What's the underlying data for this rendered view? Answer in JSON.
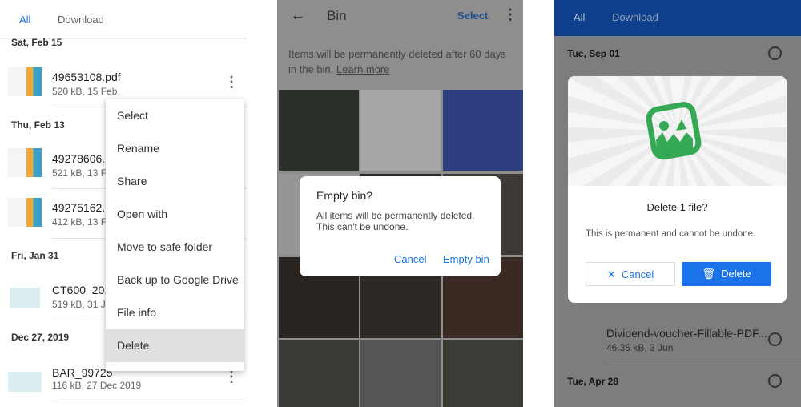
{
  "panel1": {
    "tabs": [
      "All",
      "Download"
    ],
    "groups": [
      {
        "date": "Sat, Feb 15"
      },
      {
        "date": "Thu, Feb 13"
      },
      {
        "date": "Fri, Jan 31"
      },
      {
        "date": "Dec 27, 2019"
      }
    ],
    "files": [
      {
        "name": "49653108.pdf",
        "meta": "520 kB, 15 Feb"
      },
      {
        "name": "49278606.p",
        "meta": "521 kB, 13 Fe"
      },
      {
        "name": "49275162.p",
        "meta": "412 kB, 13 Fe"
      },
      {
        "name": "CT600_201",
        "meta": "519 kB, 31 Ja"
      },
      {
        "name": "BAR_99725",
        "meta": "116 kB, 27 Dec 2019"
      }
    ],
    "menu": [
      "Select",
      "Rename",
      "Share",
      "Open with",
      "Move to safe folder",
      "Back up to Google Drive",
      "File info",
      "Delete"
    ]
  },
  "panel2": {
    "title": "Bin",
    "select": "Select",
    "notice": "Items will be permanently deleted after 60 days in the bin.",
    "learn_more": "Learn more",
    "dialog": {
      "title": "Empty bin?",
      "body1": "All items will be permanently deleted.",
      "body2": "This can't be undone.",
      "cancel": "Cancel",
      "confirm": "Empty bin"
    }
  },
  "panel3": {
    "tabs": [
      "All",
      "Download"
    ],
    "dates": [
      "Tue, Sep 01",
      "Tue, Apr 28"
    ],
    "file": {
      "name": "Dividend-voucher-Fillable-PDF...",
      "meta": "46.35 kB, 3 Jun"
    },
    "dialog": {
      "title": "Delete 1 file?",
      "body": "This is permanent and cannot be undone.",
      "cancel": "Cancel",
      "confirm": "Delete"
    },
    "colors": {
      "accent": "#1a73e8",
      "header": "#0d3f8c",
      "logo": "#34a853"
    }
  }
}
